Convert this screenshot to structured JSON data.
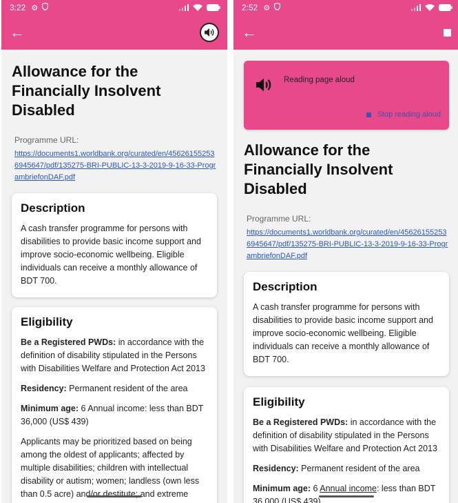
{
  "left": {
    "status": {
      "time": "3:22"
    },
    "title": "Allowance for the Financially Insolvent Disabled",
    "programme_label": "Programme URL:",
    "programme_url": "https://documents1.worldbank.org/curated/en/456261552536945647/pdf/135275-BRI-PUBLIC-13-3-2019-9-16-33-ProgrambriefonDAF.pdf",
    "description": {
      "heading": "Description",
      "text": "A cash transfer programme for persons with disabilities to provide basic income support and improve socio-economic wellbeing. Eligible individuals can receive a monthly allowance of BDT 700."
    },
    "eligibility": {
      "heading": "Eligibility",
      "pwd_label": "Be a Registered PWDs:",
      "pwd_text": " in accordance with the definition of disability stipulated in the Persons with Disabilities Welfare and Protection Act 2013",
      "residency_label": "Residency:",
      "residency_text": " Permanent resident of the area",
      "minage_label": "Minimum age:",
      "minage_text": " 6 Annual income: less than BDT 36,000 (US$ 439)",
      "priority_text": "Applicants may be prioritized based on being among the oldest of applicants; affected by multiple disabilities; children with intellectual disability or autism; women; landless (own less than 0.5 acre) and/or destitute; and extreme"
    }
  },
  "right": {
    "status": {
      "time": "2:52"
    },
    "banner": {
      "reading_text": "Reading page aloud",
      "stop_text": "Stop reading aloud"
    },
    "title": "Allowance for the Financially Insolvent Disabled",
    "programme_label": "Programme URL:",
    "programme_url": "https://documents1.worldbank.org/curated/en/456261552536945647/pdf/135275-BRI-PUBLIC-13-3-2019-9-16-33-ProgrambriefonDAF.pdf",
    "description": {
      "heading": "Description",
      "text": "A cash transfer programme for persons with disabilities to provide basic income support and improve socio-economic wellbeing. Eligible individuals can receive a monthly allowance of BDT 700."
    },
    "eligibility": {
      "heading": "Eligibility",
      "pwd_label": "Be a Registered PWDs:",
      "pwd_text": " in accordance with the definition of disability stipulated in the Persons with Disabilities Welfare and Protection Act 2013",
      "residency_label": "Residency:",
      "residency_text": " Permanent resident of the area",
      "minage_label": "Minimum age:",
      "minage_pre": " 6 ",
      "minage_highlight": "Annual income",
      "minage_post": ": less than BDT 36,000 (US$ 439)"
    }
  },
  "icons": {
    "back": "arrow-left-icon",
    "speaker": "volume-icon",
    "stop": "stop-icon",
    "settings": "gear-icon",
    "shield": "shield-icon",
    "signal": "signal-icon",
    "wifi": "wifi-icon",
    "battery": "battery-icon"
  },
  "colors": {
    "accent": "#e8498a",
    "link": "#2a55c6",
    "stop_blue": "#3f51b5"
  }
}
